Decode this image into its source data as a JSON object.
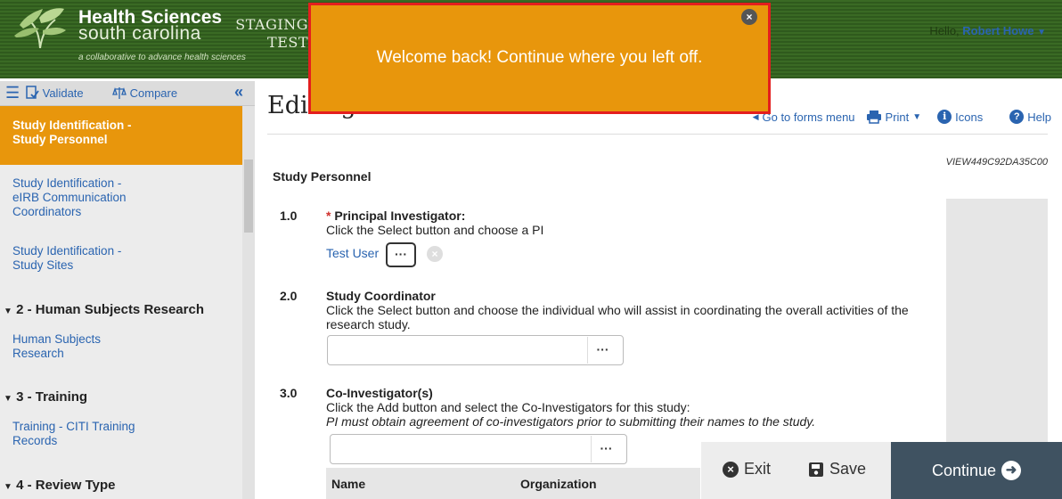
{
  "header": {
    "logo_title": "Health Sciences",
    "logo_subtitle": "south carolina",
    "logo_tagline": "a collaborative to advance health sciences",
    "staging_line1": "STAGING",
    "staging_line2": "TEST",
    "greeting": "Hello,",
    "user_name": "Robert Howe"
  },
  "toast": {
    "message": "Welcome back! Continue where you left off."
  },
  "sidebar": {
    "toolbar": {
      "validate": "Validate",
      "compare": "Compare"
    },
    "items": [
      {
        "line1": "Study Identification -",
        "line2": "Study Personnel",
        "line3": ""
      },
      {
        "line1": "Study Identification -",
        "line2": "eIRB Communication",
        "line3": "Coordinators"
      },
      {
        "line1": "Study Identification -",
        "line2": "Study Sites",
        "line3": ""
      },
      {
        "line1": "Human Subjects",
        "line2": "Research",
        "line3": ""
      },
      {
        "line1": "Training - CITI Training",
        "line2": "Records",
        "line3": ""
      }
    ],
    "sections": [
      "2 - Human Subjects Research",
      "3 - Training",
      "4 - Review Type"
    ]
  },
  "main": {
    "title": "Editing: Pro00127887",
    "links": {
      "forms_menu": "Go to forms menu",
      "print": "Print",
      "icons": "Icons",
      "help": "Help"
    },
    "view_id": "VIEW449C92DA35C00",
    "section_title": "Study Personnel",
    "questions": [
      {
        "num": "1.0",
        "label": "Principal Investigator:",
        "required": "*",
        "help": "Click the Select button and choose a PI",
        "value": "Test User"
      },
      {
        "num": "2.0",
        "label": "Study Coordinator",
        "help": "Click the Select button and choose the individual who will assist in coordinating the overall activities of the research study."
      },
      {
        "num": "3.0",
        "label": "Co-Investigator(s)",
        "help": "Click the Add button and select the Co-Investigators for this study:",
        "note": "PI must obtain agreement of co-investigators prior to submitting their names to the study."
      }
    ],
    "ellipsis": "···",
    "table_headers": [
      "Name",
      "Organization"
    ]
  },
  "footer": {
    "exit": "Exit",
    "save": "Save",
    "continue": "Continue"
  }
}
